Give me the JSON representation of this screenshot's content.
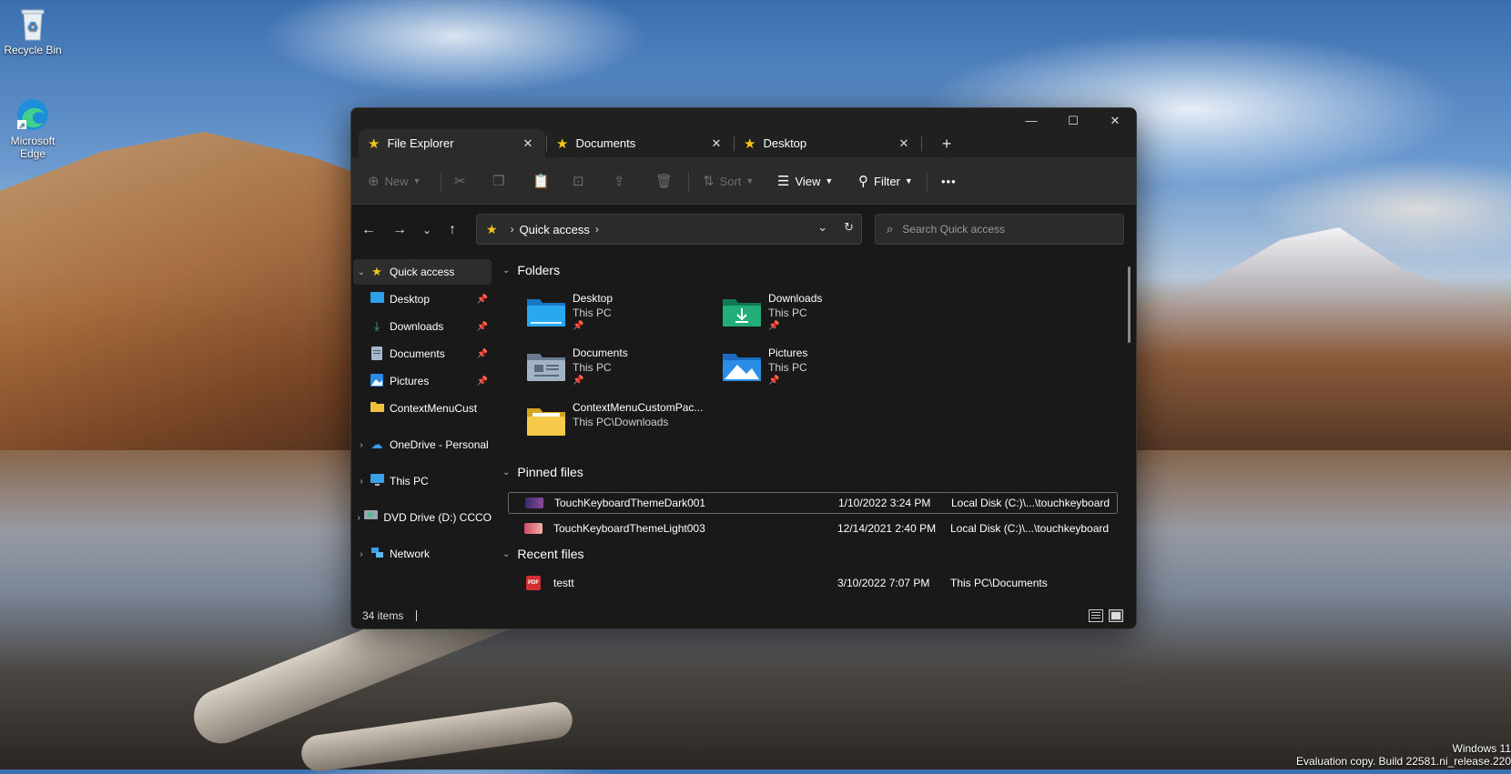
{
  "desktop": {
    "icons": [
      {
        "label": "Recycle Bin",
        "icon": "recycle-bin-icon"
      },
      {
        "label": "Microsoft Edge",
        "icon": "edge-icon"
      }
    ],
    "watermark_line1": "Windows 11",
    "watermark_line2": "Evaluation copy. Build 22581.ni_release.220"
  },
  "window": {
    "tabs": [
      {
        "label": "File Explorer",
        "close": "✕"
      },
      {
        "label": "Documents",
        "close": "✕"
      },
      {
        "label": "Desktop",
        "close": "✕"
      }
    ],
    "new_tab": "+",
    "controls": {
      "minimize": "—",
      "maximize": "☐",
      "close": "✕"
    }
  },
  "toolbar": {
    "new_label": "New",
    "sort_label": "Sort",
    "view_label": "View",
    "filter_label": "Filter",
    "more": "•••"
  },
  "address": {
    "location": "Quick access",
    "search_placeholder": "Search Quick access"
  },
  "sidebar": {
    "items": [
      {
        "label": "Quick access",
        "icon": "star-icon"
      },
      {
        "label": "Desktop",
        "icon": "desktop-folder-icon"
      },
      {
        "label": "Downloads",
        "icon": "download-icon"
      },
      {
        "label": "Documents",
        "icon": "documents-icon"
      },
      {
        "label": "Pictures",
        "icon": "pictures-icon"
      },
      {
        "label": "ContextMenuCust",
        "icon": "folder-icon"
      },
      {
        "label": "OneDrive - Personal",
        "icon": "cloud-icon"
      },
      {
        "label": "This PC",
        "icon": "pc-icon"
      },
      {
        "label": "DVD Drive (D:) CCCO",
        "icon": "dvd-icon"
      },
      {
        "label": "Network",
        "icon": "network-icon"
      }
    ]
  },
  "content": {
    "folders_heading": "Folders",
    "folders": [
      {
        "name": "Desktop",
        "location": "This PC",
        "color": "#1e9be0"
      },
      {
        "name": "Downloads",
        "location": "This PC",
        "color": "#1fa36f"
      },
      {
        "name": "Documents",
        "location": "This PC",
        "color": "#8a9bb0"
      },
      {
        "name": "Pictures",
        "location": "This PC",
        "color": "#2a8be0"
      },
      {
        "name": "ContextMenuCustomPac...",
        "location": "This PC\\Downloads",
        "color": "#f0c040"
      }
    ],
    "pinned_heading": "Pinned files",
    "pinned": [
      {
        "name": "TouchKeyboardThemeDark001",
        "date": "1/10/2022 3:24 PM",
        "location": "Local Disk (C:)\\...\\touchkeyboard",
        "color": "#5a3a8a"
      },
      {
        "name": "TouchKeyboardThemeLight003",
        "date": "12/14/2021 2:40 PM",
        "location": "Local Disk (C:)\\...\\touchkeyboard",
        "color": "#d46a7a"
      }
    ],
    "recent_heading": "Recent files",
    "recent": [
      {
        "name": "testt",
        "date": "3/10/2022 7:07 PM",
        "location": "This PC\\Documents",
        "color": "#d32f2f",
        "badge": "PDF"
      }
    ]
  },
  "status": {
    "count": "34 items"
  }
}
